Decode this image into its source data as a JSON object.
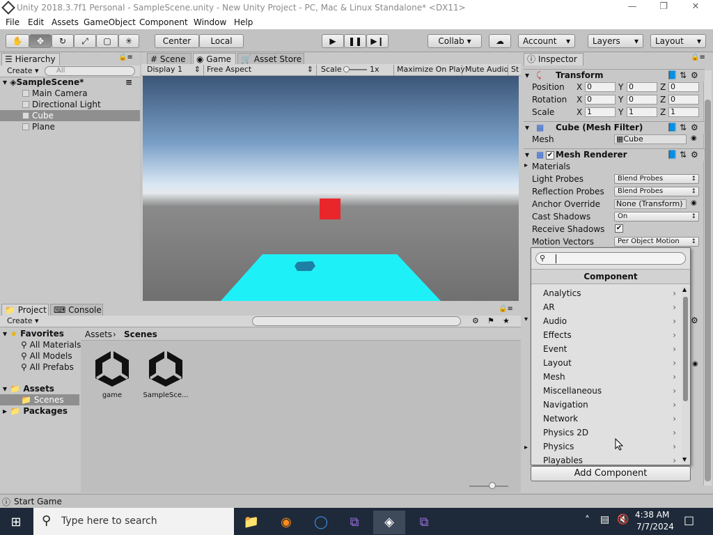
{
  "window": {
    "title": "Unity 2018.3.7f1 Personal - SampleScene.unity - New Unity Project - PC, Mac & Linux Standalone* <DX11>",
    "minimize": "—",
    "maximize": "❐",
    "close": "✕"
  },
  "menubar": [
    "File",
    "Edit",
    "Assets",
    "GameObject",
    "Component",
    "Window",
    "Help"
  ],
  "toolbar": {
    "pivot_mode": "Center",
    "pivot_rotation": "Local",
    "collab": "Collab ▾",
    "account": "Account",
    "layers": "Layers",
    "layout": "Layout"
  },
  "hierarchy": {
    "tab": "Hierarchy",
    "create": "Create ▾",
    "search_placeholder": "All",
    "scene": "SampleScene*",
    "items": [
      "Main Camera",
      "Directional Light",
      "Cube",
      "Plane"
    ],
    "selected": "Cube"
  },
  "view_tabs": [
    "Scene",
    "Game",
    "Asset Store"
  ],
  "game_toolbar": {
    "display": "Display 1",
    "aspect": "Free Aspect",
    "scale_label": "Scale",
    "scale_value": "1x",
    "maximize_on_play": "Maximize On Play",
    "mute_audio": "Mute Audio",
    "stats": "St"
  },
  "game_colors": {
    "plane": "#1ef0f8",
    "cube": "#e8262b",
    "shadow": "#1e7fa4"
  },
  "project": {
    "tabs": [
      "Project",
      "Console"
    ],
    "create": "Create ▾",
    "favorites": "Favorites",
    "favorite_items": [
      "All Materials",
      "All Models",
      "All Prefabs"
    ],
    "assets": "Assets",
    "scenes_folder": "Scenes",
    "packages": "Packages",
    "breadcrumb": [
      "Assets",
      "Scenes"
    ],
    "files": [
      "game",
      "SampleSce..."
    ]
  },
  "inspector": {
    "tab": "Inspector",
    "transform": {
      "title": "Transform",
      "rows": [
        {
          "label": "Position",
          "x": "0",
          "y": "0",
          "z": "0"
        },
        {
          "label": "Rotation",
          "x": "0",
          "y": "0",
          "z": "0"
        },
        {
          "label": "Scale",
          "x": "1",
          "y": "1",
          "z": "1"
        }
      ],
      "axis_labels": [
        "X",
        "Y",
        "Z"
      ]
    },
    "mesh_filter": {
      "title": "Cube (Mesh Filter)",
      "mesh_label": "Mesh",
      "mesh_value": "Cube"
    },
    "mesh_renderer": {
      "title": "Mesh Renderer",
      "materials": "Materials",
      "light_probes_label": "Light Probes",
      "light_probes": "Blend Probes",
      "reflection_probes_label": "Reflection Probes",
      "reflection_probes": "Blend Probes",
      "anchor_override_label": "Anchor Override",
      "anchor_override": "None (Transform)",
      "cast_shadows_label": "Cast Shadows",
      "cast_shadows": "On",
      "receive_shadows_label": "Receive Shadows",
      "receive_shadows_check": "✔",
      "motion_vectors_label": "Motion Vectors",
      "motion_vectors": "Per Object Motion"
    },
    "add_component": "Add Component"
  },
  "component_popup": {
    "title": "Component",
    "search_value": "",
    "items": [
      "Analytics",
      "AR",
      "Audio",
      "Effects",
      "Event",
      "Layout",
      "Mesh",
      "Miscellaneous",
      "Navigation",
      "Network",
      "Physics 2D",
      "Physics",
      "Playables"
    ]
  },
  "status": {
    "text": "Start Game"
  },
  "taskbar": {
    "search_placeholder": "Type here to search",
    "time": "4:38 AM",
    "date": "7/7/2024"
  }
}
